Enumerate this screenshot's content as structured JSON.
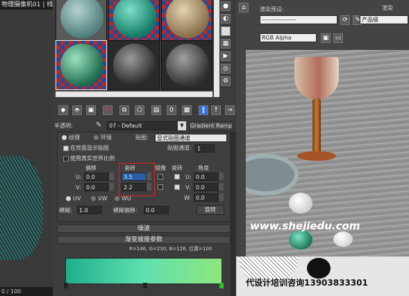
{
  "left_viewport": {
    "title": "物理摄像机01 | 线",
    "bottom_value": "0 / 100"
  },
  "editor": {
    "opacity_label": "半透明:",
    "material_name": "07 - Default",
    "map_type": "Gradient Ramp",
    "coords": {
      "texture_label": "纹理",
      "env_label": "环境",
      "mapping_label": "贴图:",
      "mapping_value": "显式贴图通道",
      "show_back_label": "在背面显示贴图",
      "map_channel_label": "贴图通道:",
      "map_channel_value": "1",
      "realworld_label": "使用真实世界比例",
      "offset_label": "偏移",
      "tiling_label": "瓷砖",
      "mirror_label": "镜像",
      "tile_label": "瓷砖",
      "angle_label": "角度",
      "u_label": "U:",
      "v_label": "V:",
      "w_label": "W:",
      "u_offset": "0.0",
      "v_offset": "0.0",
      "u_tiling": "3.5",
      "v_tiling": "2.2",
      "u_angle": "0.0",
      "v_angle": "0.0",
      "w_angle": "0.0",
      "uv_label": "UV",
      "vw_label": "VW",
      "wu_label": "WU",
      "blur_label": "模糊:",
      "blur_value": "1.0",
      "blur_offset_label": "模糊偏移:",
      "blur_offset_value": "0.0",
      "rotate_button": "旋转"
    },
    "noise_rollout": "噪波",
    "gradient_rollout": "渐变坡度参数",
    "gradient_info": "R=146, G=230, B=126,  位置=100",
    "gradient_colors": [
      "#1fae8c",
      "#5fe0b0",
      "#8ee67e"
    ]
  },
  "right": {
    "preset_label": "渲染预设:",
    "preset_value": "-----------------",
    "render_label": "渲染",
    "product_label": "产品级",
    "channel_value": "RGB Alpha",
    "watermark": "www.shejiedu.com",
    "footer_text": "代设计培训咨询13903833301"
  }
}
